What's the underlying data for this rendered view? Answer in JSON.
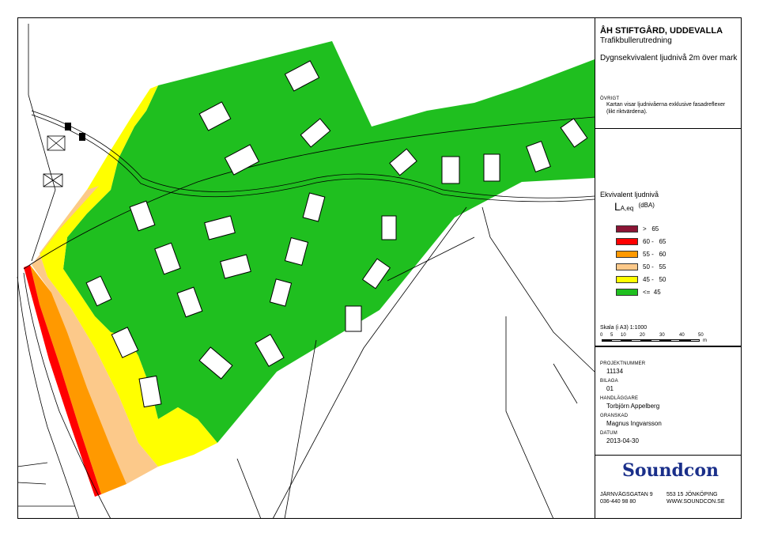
{
  "title": "ÅH STIFTGÅRD, UDDEVALLA",
  "subtitle": "Trafikbullerutredning",
  "description": "Dygnsekvivalent ljudnivå 2m över mark",
  "note_label": "ÖVRIGT",
  "note_text_1": "Kartan visar ljudnivåerna exklusive fasadreflexer",
  "note_text_2": "(likt riktvärdena).",
  "legend_title": "Ekvivalent ljudnivå",
  "legend_symbol": "L",
  "legend_subscript": "A,eq",
  "legend_unit": "(dBA)",
  "legend": [
    {
      "label": ">   65",
      "color": "#8b1535"
    },
    {
      "label": "60 -   65",
      "color": "#ff0000"
    },
    {
      "label": "55 -   60",
      "color": "#ff9900"
    },
    {
      "label": "50 -   55",
      "color": "#fcc98a"
    },
    {
      "label": "45 -   50",
      "color": "#ffff00"
    },
    {
      "label": "<=  45",
      "color": "#1fbf1f"
    }
  ],
  "scale_text": "Skala (i A3) 1:1000",
  "scale_ticks": [
    "0",
    "5",
    "10",
    "20",
    "30",
    "40",
    "50"
  ],
  "scale_unit": "m",
  "project_label": "PROJEKTNUMMER",
  "project_value": "11134",
  "appendix_label": "BILAGA",
  "appendix_value": "01",
  "handler_label": "HANDLÄGGARE",
  "handler_value": "Torbjörn Appelberg",
  "reviewer_label": "GRANSKAD",
  "reviewer_value": "Magnus Ingvarsson",
  "date_label": "DATUM",
  "date_value": "2013-04-30",
  "company_logo": "Soundcon",
  "address_1": "JÄRNVÄGSGATAN 9",
  "address_2": "553 15 JÖNKÖPING",
  "phone": "036-440 98 80",
  "web": "WWW.SOUNDCON.SE"
}
